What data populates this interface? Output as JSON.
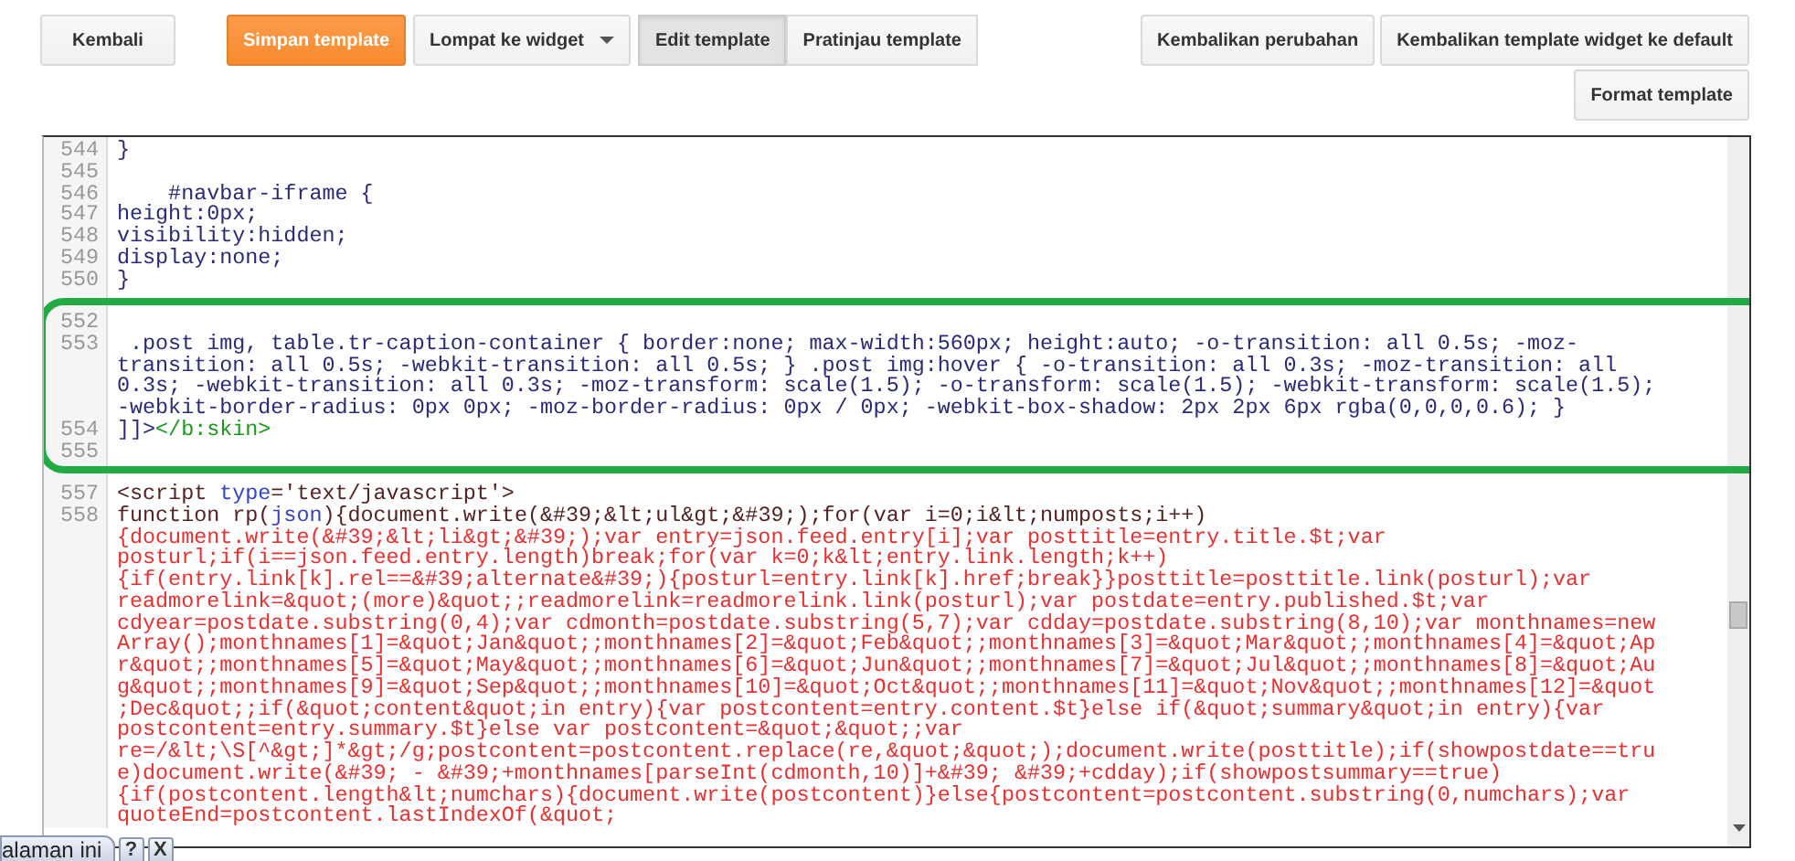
{
  "toolbar": {
    "left_buttons": [
      {
        "label": "Kembali",
        "kind": "default"
      },
      {
        "label": "Simpan template",
        "kind": "primary"
      },
      {
        "label": "Lompat ke widget",
        "kind": "dropdown"
      }
    ],
    "view_tabs": [
      {
        "label": "Edit template",
        "selected": true
      },
      {
        "label": "Pratinjau template",
        "selected": false
      }
    ],
    "right_buttons": [
      {
        "label": "Kembalikan perubahan",
        "kind": "default"
      },
      {
        "label": "Kembalikan template widget ke default",
        "kind": "default"
      }
    ],
    "second_row_buttons": [
      {
        "label": "Format template",
        "kind": "default"
      }
    ]
  },
  "editor": {
    "lines": [
      {
        "number": "544",
        "rows": [
          [
            {
              "text": "}",
              "kind": "css"
            }
          ]
        ]
      },
      {
        "number": "545",
        "rows": [
          []
        ]
      },
      {
        "number": "546",
        "rows": [
          [
            {
              "text": "    #navbar-iframe {",
              "kind": "css"
            }
          ]
        ]
      },
      {
        "number": "547",
        "rows": [
          [
            {
              "text": "height:0px;",
              "kind": "css"
            }
          ]
        ]
      },
      {
        "number": "548",
        "rows": [
          [
            {
              "text": "visibility:hidden;",
              "kind": "css"
            }
          ]
        ]
      },
      {
        "number": "549",
        "rows": [
          [
            {
              "text": "display:none;",
              "kind": "css"
            }
          ]
        ]
      },
      {
        "number": "550",
        "rows": [
          [
            {
              "text": "}",
              "kind": "css"
            }
          ]
        ]
      },
      {
        "rows": [
          []
        ]
      },
      {
        "number": "552",
        "rows": [
          []
        ]
      },
      {
        "number": "553",
        "rows": [
          [
            {
              "text": " .post img, table.tr-caption-container { border:none; max-width:560px; height:auto; -o-transition: all 0.5s; -moz-",
              "kind": "css"
            }
          ],
          [
            {
              "text": "transition: all 0.5s; -webkit-transition: all 0.5s; } .post img:hover { -o-transition: all 0.3s; -moz-transition: all",
              "kind": "css"
            }
          ],
          [
            {
              "text": "0.3s; -webkit-transition: all 0.3s; -moz-transform: scale(1.5); -o-transform: scale(1.5); -webkit-transform: scale(1.5);",
              "kind": "css"
            }
          ],
          [
            {
              "text": "-webkit-border-radius: 0px 0px; -moz-border-radius: 0px / 0px; -webkit-box-shadow: 2px 2px 6px rgba(0,0,0,0.6); }",
              "kind": "css"
            }
          ]
        ]
      },
      {
        "number": "554",
        "rows": [
          [
            {
              "text": "]]>",
              "kind": "css"
            },
            {
              "text": "</b:skin>",
              "kind": "tag"
            }
          ]
        ]
      },
      {
        "number": "555",
        "rows": [
          []
        ]
      },
      {
        "rows": [
          []
        ]
      },
      {
        "number": "557",
        "rows": [
          [
            {
              "text": "<script ",
              "kind": "plain"
            },
            {
              "text": "type",
              "kind": "attr"
            },
            {
              "text": "='text/javascript'>",
              "kind": "plain"
            }
          ]
        ]
      },
      {
        "number": "558",
        "rows": [
          [
            {
              "text": "function rp(",
              "kind": "plain"
            },
            {
              "text": "json",
              "kind": "attr"
            },
            {
              "text": "){document.write(&#39;&lt;ul&gt;&#39;);for(var i=0;i&lt;numposts;i++)",
              "kind": "plain"
            }
          ],
          [
            {
              "text": "{document.write(&#39;&lt;li&gt;&#39;);var entry=json.feed.entry[i];var posttitle=entry.title.$t;var",
              "kind": "js"
            }
          ],
          [
            {
              "text": "posturl;if(i==json.feed.entry.length)break;for(var k=0;k&lt;entry.link.length;k++)",
              "kind": "js"
            }
          ],
          [
            {
              "text": "{if(entry.link[k].rel==&#39;alternate&#39;){posturl=entry.link[k].href;break}}posttitle=posttitle.link(posturl);var",
              "kind": "js"
            }
          ],
          [
            {
              "text": "readmorelink=&quot;(more)&quot;;readmorelink=readmorelink.link(posturl);var postdate=entry.published.$t;var",
              "kind": "js"
            }
          ],
          [
            {
              "text": "cdyear=postdate.substring(0,4);var cdmonth=postdate.substring(5,7);var cdday=postdate.substring(8,10);var monthnames=new",
              "kind": "js"
            }
          ],
          [
            {
              "text": "Array();monthnames[1]=&quot;Jan&quot;;monthnames[2]=&quot;Feb&quot;;monthnames[3]=&quot;Mar&quot;;monthnames[4]=&quot;Ap",
              "kind": "js"
            }
          ],
          [
            {
              "text": "r&quot;;monthnames[5]=&quot;May&quot;;monthnames[6]=&quot;Jun&quot;;monthnames[7]=&quot;Jul&quot;;monthnames[8]=&quot;Au",
              "kind": "js"
            }
          ],
          [
            {
              "text": "g&quot;;monthnames[9]=&quot;Sep&quot;;monthnames[10]=&quot;Oct&quot;;monthnames[11]=&quot;Nov&quot;;monthnames[12]=&quot",
              "kind": "js"
            }
          ],
          [
            {
              "text": ";Dec&quot;;if(&quot;content&quot;in entry){var postcontent=entry.content.$t}else if(&quot;summary&quot;in entry){var",
              "kind": "js"
            }
          ],
          [
            {
              "text": "postcontent=entry.summary.$t}else var postcontent=&quot;&quot;;var",
              "kind": "js"
            }
          ],
          [
            {
              "text": "re=/&lt;\\S[^&gt;]*&gt;/g;postcontent=postcontent.replace(re,&quot;&quot;);document.write(posttitle);if(showpostdate==tru",
              "kind": "js"
            }
          ],
          [
            {
              "text": "e)document.write(&#39; - &#39;+monthnames[parseInt(cdmonth,10)]+&#39; &#39;+cdday);if(showpostsummary==true)",
              "kind": "js"
            }
          ],
          [
            {
              "text": "{if(postcontent.length&lt;numchars){document.write(postcontent)}else{postcontent=postcontent.substring(0,numchars);var",
              "kind": "js"
            }
          ],
          [
            {
              "text": "quoteEnd=postcontent.lastIndexOf(&quot;",
              "kind": "js"
            }
          ]
        ]
      }
    ]
  },
  "translate_bar": {
    "label": "alaman ini",
    "help": "?",
    "close": "X"
  }
}
